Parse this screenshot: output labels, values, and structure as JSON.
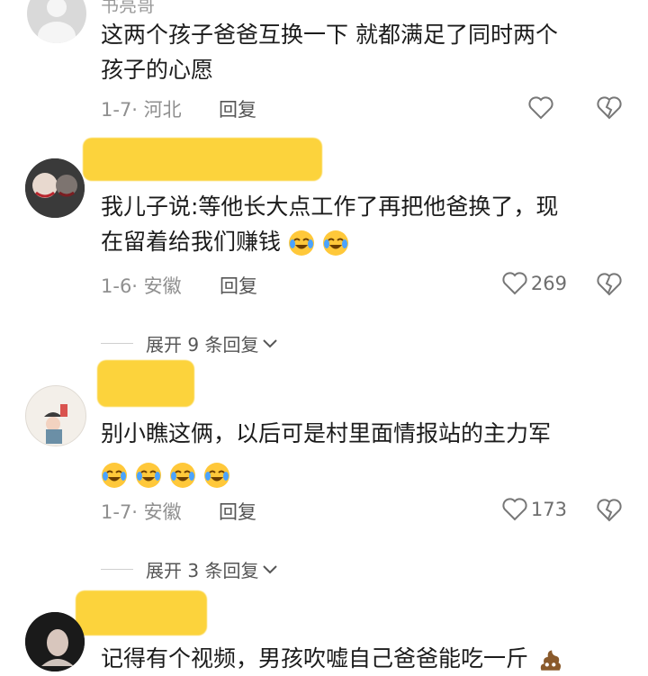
{
  "comments": [
    {
      "username": "书亮哥",
      "text_lines": [
        "这两个孩子爸爸互换一下 就都满足了同时两个",
        "孩子的心愿"
      ],
      "date_location": "1-7· 河北",
      "reply_label": "回复",
      "likes": ""
    },
    {
      "username": "",
      "text_lines": [
        "我儿子说:等他长大点工作了再把他爸换了，现",
        "在留着给我们赚钱"
      ],
      "date_location": "1-6· 安徽",
      "reply_label": "回复",
      "likes": "269"
    },
    {
      "username": "",
      "text_lines": [
        "别小瞧这俩，以后可是村里面情报站的主力军"
      ],
      "date_location": "1-7· 安徽",
      "reply_label": "回复",
      "likes": "173"
    },
    {
      "username": "",
      "text_lines": [
        "记得有个视频，男孩吹嘘自己爸爸能吃一斤"
      ],
      "date_location": "",
      "reply_label": "",
      "likes": ""
    }
  ],
  "expand_1": "展开 9 条回复",
  "expand_2": "展开 3 条回复",
  "colors": {
    "mask": "#fcd33c",
    "meta": "#8f8f8f"
  },
  "icons": [
    "heart-icon",
    "broken-heart-icon",
    "chevron-down-icon",
    "laughing-crying-emoji",
    "poop-emoji"
  ]
}
